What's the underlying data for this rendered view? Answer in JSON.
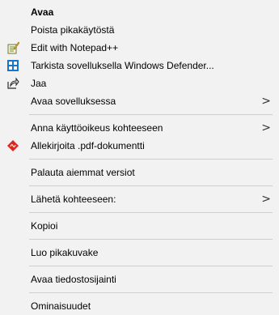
{
  "menu": {
    "items": [
      {
        "label": "Avaa"
      },
      {
        "label": "Poista pikakäytöstä"
      },
      {
        "label": "Edit with Notepad++",
        "icon": "notepad-plus-plus-icon"
      },
      {
        "label": "Tarkista sovelluksella Windows Defender...",
        "icon": "windows-defender-icon"
      },
      {
        "label": "Jaa",
        "icon": "share-icon"
      },
      {
        "label": "Avaa sovelluksessa",
        "submenu": true
      },
      {
        "label": "Anna käyttöoikeus kohteeseen",
        "submenu": true
      },
      {
        "label": "Allekirjoita .pdf-dokumentti",
        "icon": "pdf-sign-icon"
      },
      {
        "label": "Palauta aiemmat versiot"
      },
      {
        "label": "Lähetä kohteeseen:",
        "submenu": true
      },
      {
        "label": "Kopioi"
      },
      {
        "label": "Luo pikakuvake"
      },
      {
        "label": "Avaa tiedostosijainti"
      },
      {
        "label": "Ominaisuudet"
      }
    ],
    "submenu_glyph": ">"
  }
}
